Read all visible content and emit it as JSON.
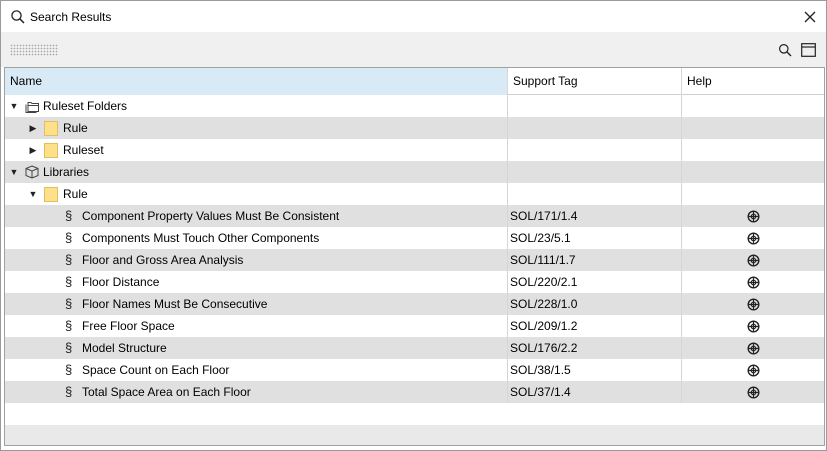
{
  "window": {
    "title": "Search Results"
  },
  "columns": {
    "name": "Name",
    "support_tag": "Support Tag",
    "help": "Help"
  },
  "icons": {
    "title": "search-icon",
    "close": "close-icon",
    "toolbar_search": "search-icon",
    "toolbar_panel": "panel-layout-icon",
    "folder": "folder-icon",
    "ruleset_folders": "ruleset-folders-icon",
    "libraries": "library-box-icon",
    "rule": "section-sign-icon",
    "help": "lifebuoy-icon"
  },
  "colors": {
    "header_selected": "#d9eaf7",
    "row_alt": "#e0e0e0",
    "folder": "#ffe08a"
  },
  "tree": {
    "ruleset_folders": {
      "label": "Ruleset Folders",
      "expanded": true,
      "children": [
        {
          "label": "Rule",
          "expanded": false
        },
        {
          "label": "Ruleset",
          "expanded": false
        }
      ]
    },
    "libraries": {
      "label": "Libraries",
      "expanded": true,
      "folder": {
        "label": "Rule",
        "expanded": true
      }
    }
  },
  "rules": [
    {
      "name": "Component Property Values Must Be Consistent",
      "tag": "SOL/171/1.4"
    },
    {
      "name": "Components Must Touch Other Components",
      "tag": "SOL/23/5.1"
    },
    {
      "name": "Floor and Gross Area Analysis",
      "tag": "SOL/111/1.7"
    },
    {
      "name": "Floor Distance",
      "tag": "SOL/220/2.1"
    },
    {
      "name": "Floor Names Must Be Consecutive",
      "tag": "SOL/228/1.0"
    },
    {
      "name": "Free Floor Space",
      "tag": "SOL/209/1.2"
    },
    {
      "name": "Model Structure",
      "tag": "SOL/176/2.2"
    },
    {
      "name": "Space Count on Each Floor",
      "tag": "SOL/38/1.5"
    },
    {
      "name": "Total Space Area on Each Floor",
      "tag": "SOL/37/1.4"
    }
  ]
}
